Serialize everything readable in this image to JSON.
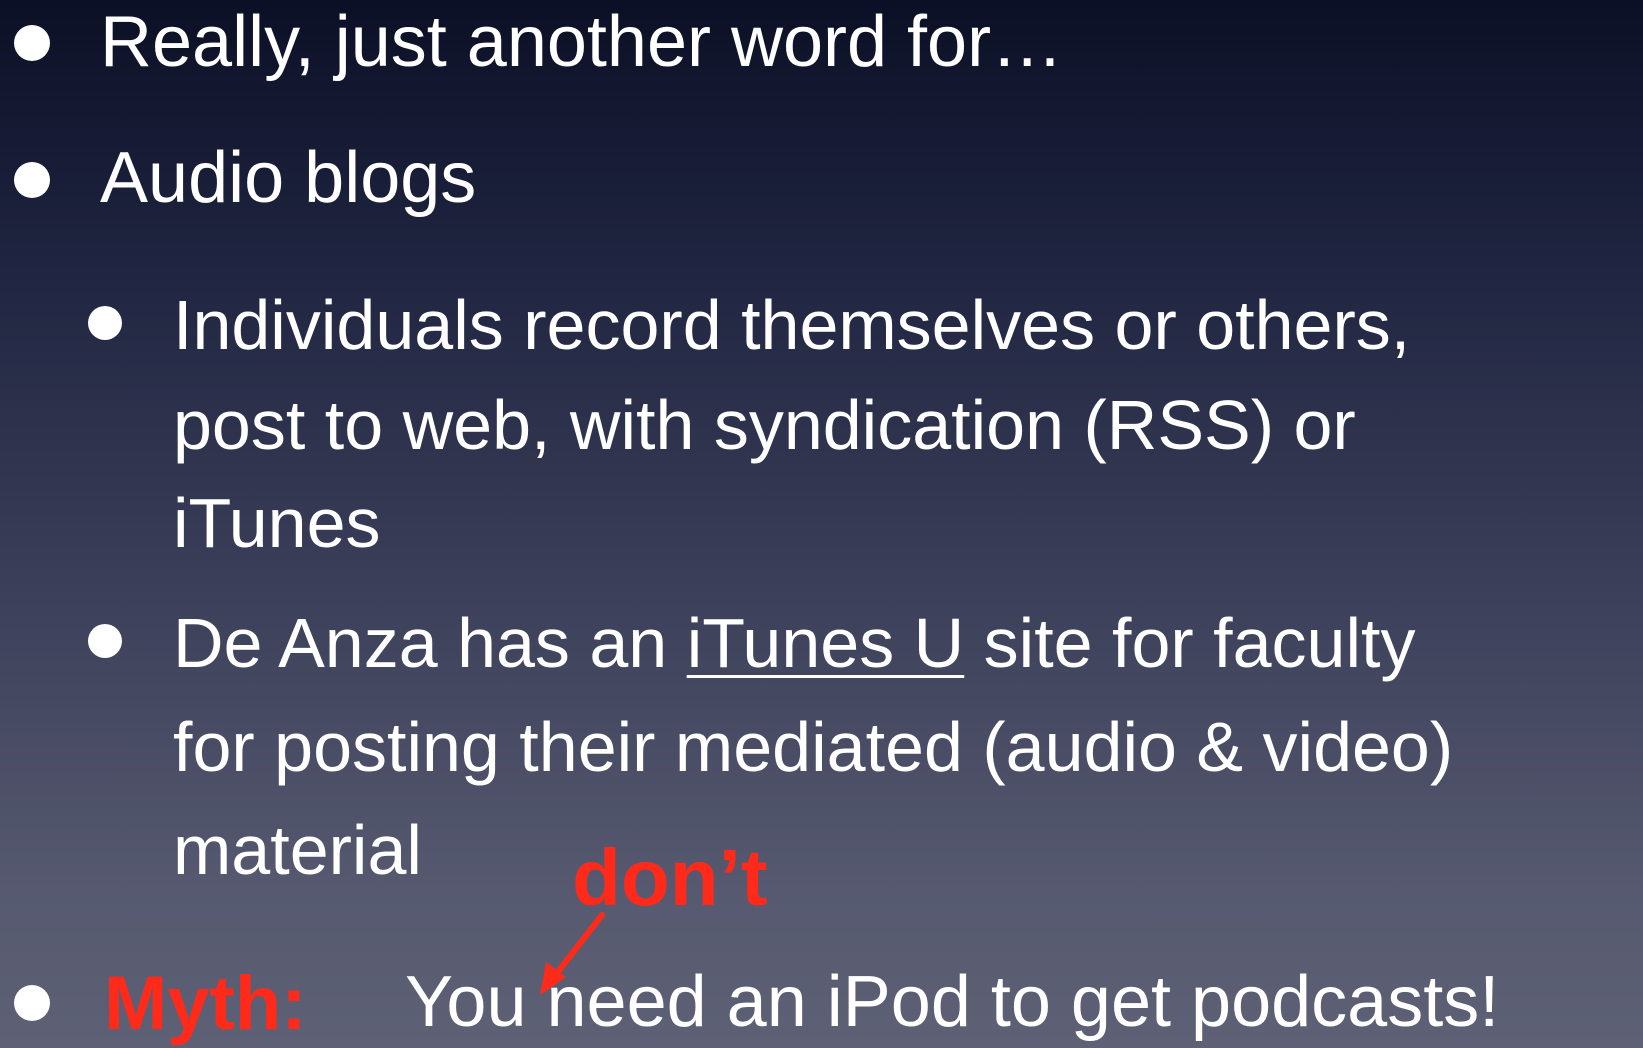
{
  "slide": {
    "bullets": [
      {
        "text": "Really, just another word for…"
      },
      {
        "text": "Audio blogs"
      },
      {
        "line1": "Individuals record themselves or others,",
        "line2": "post to web, with syndication (RSS) or",
        "line3": "iTunes"
      },
      {
        "line1_before": "De Anza has an ",
        "line1_link": "iTunes U",
        "line1_after": " site for faculty",
        "line2": "for posting their mediated (audio & video)",
        "line3": "material"
      },
      {
        "myth_label": "Myth:",
        "text": "You need an iPod to get podcasts!"
      }
    ],
    "annotation": {
      "text": "don’t",
      "color": "#ff2a1a"
    },
    "colors": {
      "text": "#ffffff",
      "highlight": "#ff2a1a",
      "background_top": "#0c1026",
      "background_bottom": "#5e6175"
    }
  }
}
